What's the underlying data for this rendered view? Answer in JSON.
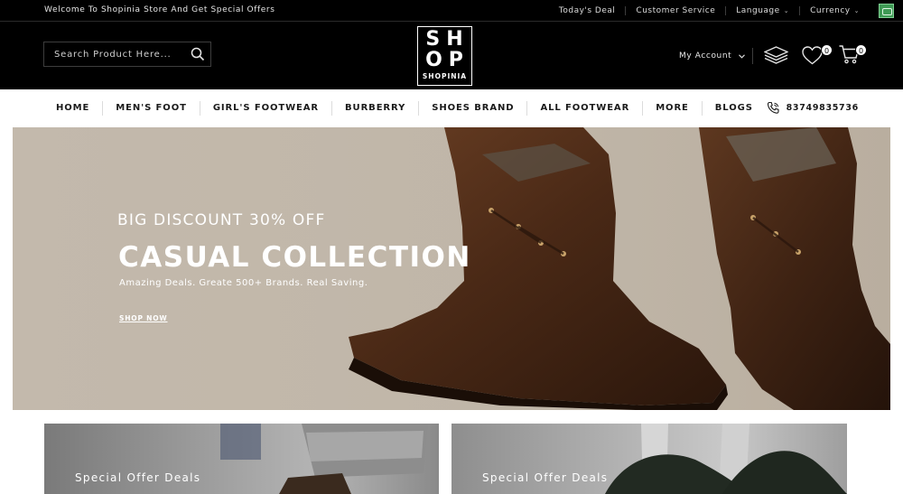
{
  "topbar": {
    "welcome": "Welcome To Shopinia Store And Get Special Offers",
    "links": [
      {
        "label": "Today's Deal"
      },
      {
        "label": "Customer Service"
      },
      {
        "label": "Language"
      },
      {
        "label": "Currency"
      }
    ]
  },
  "header": {
    "search_placeholder": "Search Product Here...",
    "logo": {
      "line1": "SH",
      "line2": "OP",
      "line3": "SHOPINIA"
    },
    "account_label": "My Account",
    "wishlist_count": "0",
    "cart_count": "0"
  },
  "nav": {
    "items": [
      "HOME",
      "MEN'S FOOT",
      "GIRL'S FOOTWEAR",
      "BURBERRY",
      "SHOES BRAND",
      "ALL FOOTWEAR",
      "MORE",
      "BLOGS"
    ],
    "phone": "83749835736"
  },
  "hero": {
    "discount": "BIG DISCOUNT 30% OFF",
    "headline": "CASUAL COLLECTION",
    "tagline": "Amazing Deals. Greate 500+ Brands. Real Saving.",
    "cta": "SHOP NOW"
  },
  "banners": [
    {
      "label": "Special Offer Deals"
    },
    {
      "label": "Special Offer Deals"
    }
  ],
  "colors": {
    "header_bg": "#000000",
    "hero_bg": "#c1b7aa",
    "nav_text": "#1a1a1a"
  }
}
